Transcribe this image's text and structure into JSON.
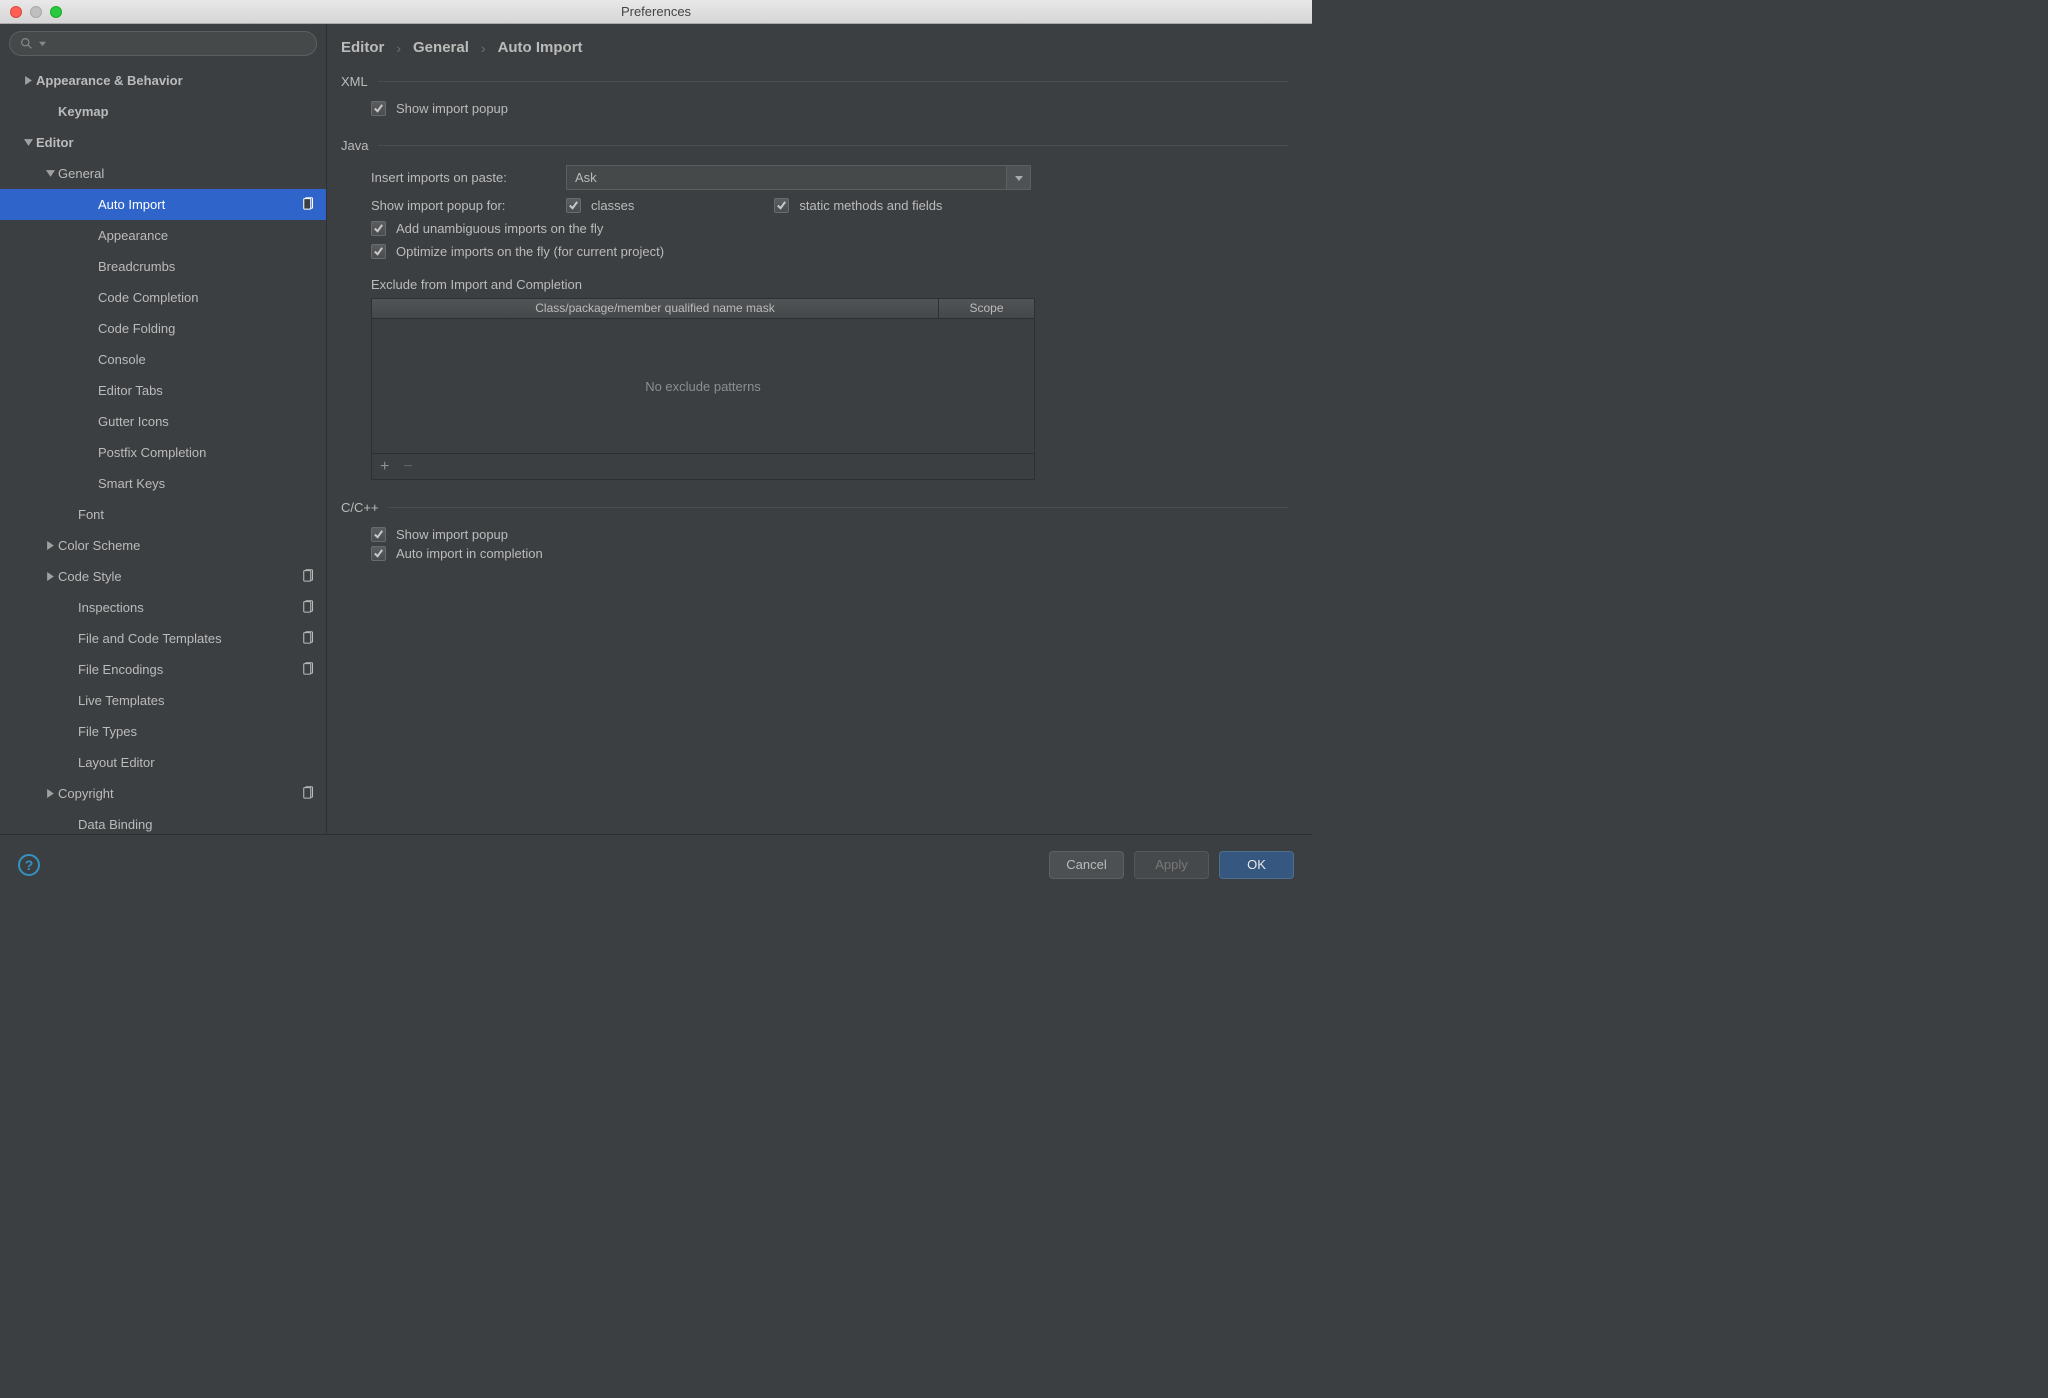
{
  "window": {
    "title": "Preferences"
  },
  "sidebar": {
    "items": [
      {
        "label": "Appearance & Behavior",
        "bold": true,
        "arrow": "right",
        "indent": 20
      },
      {
        "label": "Keymap",
        "bold": true,
        "arrow": "none",
        "indent": 42
      },
      {
        "label": "Editor",
        "bold": true,
        "arrow": "down",
        "indent": 20
      },
      {
        "label": "General",
        "bold": false,
        "arrow": "down",
        "indent": 42
      },
      {
        "label": "Auto Import",
        "bold": false,
        "arrow": "none",
        "indent": 82,
        "selected": true,
        "project": true
      },
      {
        "label": "Appearance",
        "bold": false,
        "arrow": "none",
        "indent": 82
      },
      {
        "label": "Breadcrumbs",
        "bold": false,
        "arrow": "none",
        "indent": 82
      },
      {
        "label": "Code Completion",
        "bold": false,
        "arrow": "none",
        "indent": 82
      },
      {
        "label": "Code Folding",
        "bold": false,
        "arrow": "none",
        "indent": 82
      },
      {
        "label": "Console",
        "bold": false,
        "arrow": "none",
        "indent": 82
      },
      {
        "label": "Editor Tabs",
        "bold": false,
        "arrow": "none",
        "indent": 82
      },
      {
        "label": "Gutter Icons",
        "bold": false,
        "arrow": "none",
        "indent": 82
      },
      {
        "label": "Postfix Completion",
        "bold": false,
        "arrow": "none",
        "indent": 82
      },
      {
        "label": "Smart Keys",
        "bold": false,
        "arrow": "none",
        "indent": 82
      },
      {
        "label": "Font",
        "bold": false,
        "arrow": "none",
        "indent": 62
      },
      {
        "label": "Color Scheme",
        "bold": false,
        "arrow": "right",
        "indent": 42
      },
      {
        "label": "Code Style",
        "bold": false,
        "arrow": "right",
        "indent": 42,
        "project": true
      },
      {
        "label": "Inspections",
        "bold": false,
        "arrow": "none",
        "indent": 62,
        "project": true
      },
      {
        "label": "File and Code Templates",
        "bold": false,
        "arrow": "none",
        "indent": 62,
        "project": true
      },
      {
        "label": "File Encodings",
        "bold": false,
        "arrow": "none",
        "indent": 62,
        "project": true
      },
      {
        "label": "Live Templates",
        "bold": false,
        "arrow": "none",
        "indent": 62
      },
      {
        "label": "File Types",
        "bold": false,
        "arrow": "none",
        "indent": 62
      },
      {
        "label": "Layout Editor",
        "bold": false,
        "arrow": "none",
        "indent": 62
      },
      {
        "label": "Copyright",
        "bold": false,
        "arrow": "right",
        "indent": 42,
        "project": true
      },
      {
        "label": "Data Binding",
        "bold": false,
        "arrow": "none",
        "indent": 62
      }
    ]
  },
  "breadcrumb": [
    "Editor",
    "General",
    "Auto Import"
  ],
  "xml": {
    "header": "XML",
    "show_popup": "Show import popup"
  },
  "java": {
    "header": "Java",
    "insert_label": "Insert imports on paste:",
    "insert_value": "Ask",
    "popup_for_label": "Show import popup for:",
    "classes": "classes",
    "static": "static methods and fields",
    "unambiguous": "Add unambiguous imports on the fly",
    "optimize": "Optimize imports on the fly (for current project)",
    "exclude_header": "Exclude from Import and Completion",
    "col_name": "Class/package/member qualified name mask",
    "col_scope": "Scope",
    "empty": "No exclude patterns"
  },
  "cpp": {
    "header": "C/C++",
    "show_popup": "Show import popup",
    "auto_import": "Auto import in completion"
  },
  "footer": {
    "cancel": "Cancel",
    "apply": "Apply",
    "ok": "OK"
  }
}
